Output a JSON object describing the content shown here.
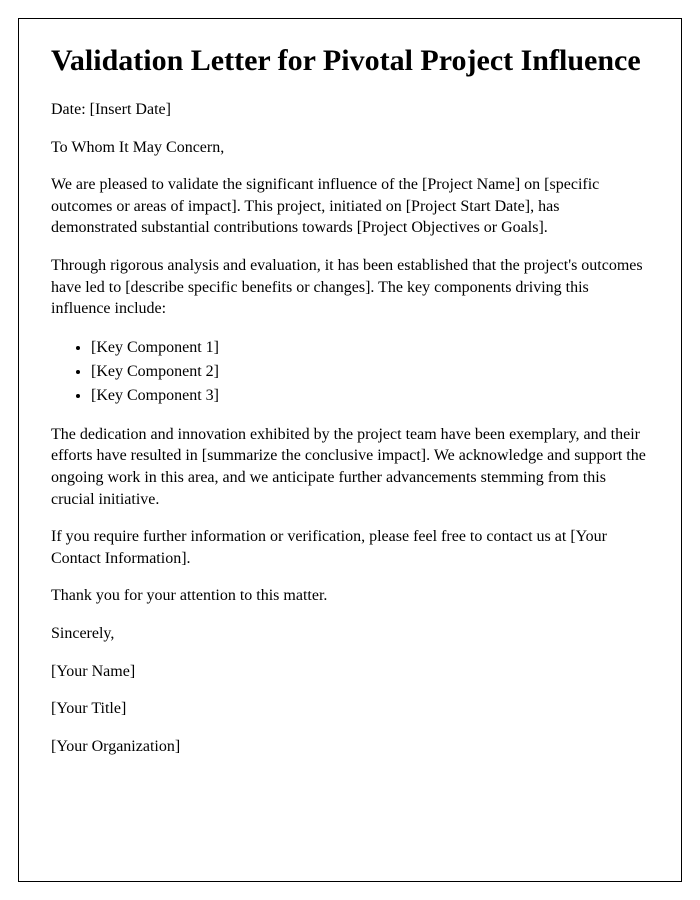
{
  "title": "Validation Letter for Pivotal Project Influence",
  "date_line": "Date: [Insert Date]",
  "salutation": "To Whom It May Concern,",
  "paragraph1": "We are pleased to validate the significant influence of the [Project Name] on [specific outcomes or areas of impact]. This project, initiated on [Project Start Date], has demonstrated substantial contributions towards [Project Objectives or Goals].",
  "paragraph2": "Through rigorous analysis and evaluation, it has been established that the project's outcomes have led to [describe specific benefits or changes]. The key components driving this influence include:",
  "components": [
    "[Key Component 1]",
    "[Key Component 2]",
    "[Key Component 3]"
  ],
  "paragraph3": "The dedication and innovation exhibited by the project team have been exemplary, and their efforts have resulted in [summarize the conclusive impact]. We acknowledge and support the ongoing work in this area, and we anticipate further advancements stemming from this crucial initiative.",
  "paragraph4": "If you require further information or verification, please feel free to contact us at [Your Contact Information].",
  "thanks": "Thank you for your attention to this matter.",
  "closing": "Sincerely,",
  "signature_name": "[Your Name]",
  "signature_title": "[Your Title]",
  "signature_org": "[Your Organization]"
}
